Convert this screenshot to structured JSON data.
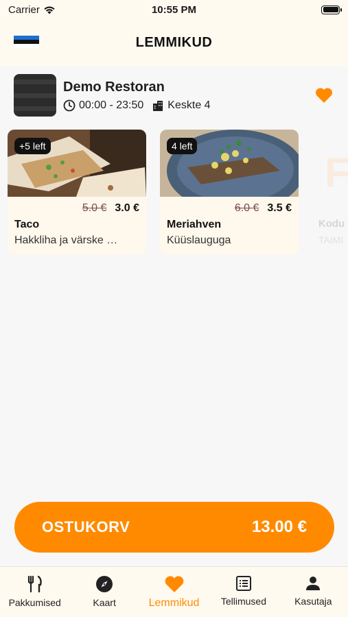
{
  "status_bar": {
    "carrier": "Carrier",
    "time": "10:55 PM"
  },
  "header": {
    "title": "LEMMIKUD"
  },
  "restaurant": {
    "name": "Demo Restoran",
    "hours": "00:00 - 23:50",
    "address": "Keskte 4"
  },
  "offers": [
    {
      "badge": "+5 left",
      "old_price": "5.0 €",
      "price": "3.0 €",
      "name": "Taco",
      "description": "Hakkliha ja värske …"
    },
    {
      "badge": "4 left",
      "old_price": "6.0 €",
      "price": "3.5 €",
      "name": "Meriahven",
      "description": "Küüslauguga"
    }
  ],
  "partial_offer": {
    "letter": "F",
    "name": "Kodu",
    "description": "TAIMI"
  },
  "cart": {
    "label": "OSTUKORV",
    "total": "13.00 €"
  },
  "tabs": [
    {
      "label": "Pakkumised",
      "icon": "fork-knife-icon"
    },
    {
      "label": "Kaart",
      "icon": "compass-icon"
    },
    {
      "label": "Lemmikud",
      "icon": "heart-icon",
      "active": true
    },
    {
      "label": "Tellimused",
      "icon": "list-icon"
    },
    {
      "label": "Kasutaja",
      "icon": "user-icon"
    }
  ],
  "colors": {
    "accent": "#ff8a00",
    "header_bg": "#fffaf0",
    "card_bg": "#fff8ec"
  }
}
